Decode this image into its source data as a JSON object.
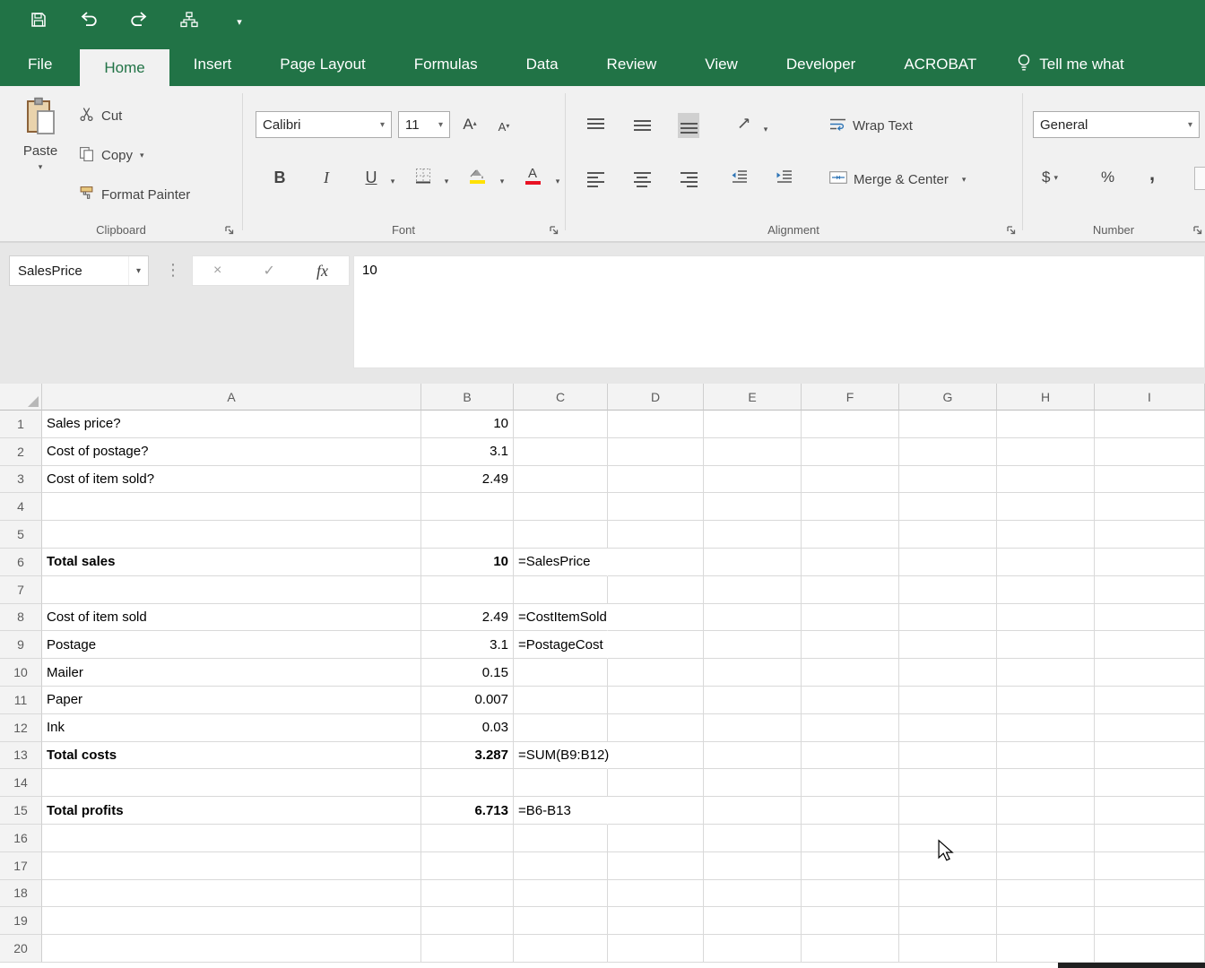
{
  "titlebar": {
    "quick_access_icons": [
      "save-icon",
      "undo-icon",
      "redo-icon",
      "org-chart-icon",
      "customize-quick-access-icon"
    ]
  },
  "ribbon": {
    "tabs": [
      {
        "label": "File",
        "active": false
      },
      {
        "label": "Home",
        "active": true
      },
      {
        "label": "Insert",
        "active": false
      },
      {
        "label": "Page Layout",
        "active": false
      },
      {
        "label": "Formulas",
        "active": false
      },
      {
        "label": "Data",
        "active": false
      },
      {
        "label": "Review",
        "active": false
      },
      {
        "label": "View",
        "active": false
      },
      {
        "label": "Developer",
        "active": false
      },
      {
        "label": "ACROBAT",
        "active": false
      }
    ],
    "tell_me": "Tell me what",
    "groups": {
      "clipboard": {
        "label": "Clipboard",
        "paste": "Paste",
        "cut": "Cut",
        "copy": "Copy",
        "format_painter": "Format Painter"
      },
      "font": {
        "label": "Font",
        "font_name": "Calibri",
        "font_size": "11",
        "bold": "B",
        "italic": "I",
        "underline": "U"
      },
      "alignment": {
        "label": "Alignment",
        "wrap_text": "Wrap Text",
        "merge_center": "Merge & Center"
      },
      "number": {
        "label": "Number",
        "format": "General",
        "currency": "$",
        "percent": "%",
        "comma": ","
      }
    }
  },
  "formula_bar": {
    "name_box": "SalesPrice",
    "cancel": "×",
    "enter": "✓",
    "fx": "fx",
    "content": "10"
  },
  "grid": {
    "columns": [
      "A",
      "B",
      "C",
      "D",
      "E",
      "F",
      "G",
      "H",
      "I"
    ],
    "rows": [
      {
        "n": "1",
        "a": "Sales price?",
        "b": "10",
        "c": ""
      },
      {
        "n": "2",
        "a": "Cost of postage?",
        "b": "3.1",
        "c": ""
      },
      {
        "n": "3",
        "a": "Cost of item sold?",
        "b": "2.49",
        "c": ""
      },
      {
        "n": "4",
        "a": "",
        "b": "",
        "c": ""
      },
      {
        "n": "5",
        "a": "",
        "b": "",
        "c": ""
      },
      {
        "n": "6",
        "a": "Total sales",
        "b": "10",
        "c": "=SalesPrice",
        "bold": true
      },
      {
        "n": "7",
        "a": "",
        "b": "",
        "c": ""
      },
      {
        "n": "8",
        "a": "Cost of item sold",
        "b": "2.49",
        "c": "=CostItemSold"
      },
      {
        "n": "9",
        "a": "Postage",
        "b": "3.1",
        "c": "=PostageCost"
      },
      {
        "n": "10",
        "a": "Mailer",
        "b": "0.15",
        "c": ""
      },
      {
        "n": "11",
        "a": "Paper",
        "b": "0.007",
        "c": ""
      },
      {
        "n": "12",
        "a": "Ink",
        "b": "0.03",
        "c": ""
      },
      {
        "n": "13",
        "a": "Total costs",
        "b": "3.287",
        "c": "=SUM(B9:B12)",
        "bold": true
      },
      {
        "n": "14",
        "a": "",
        "b": "",
        "c": ""
      },
      {
        "n": "15",
        "a": "Total profits",
        "b": "6.713",
        "c": "=B6-B13",
        "bold": true
      },
      {
        "n": "16",
        "a": "",
        "b": "",
        "c": ""
      },
      {
        "n": "17",
        "a": "",
        "b": "",
        "c": ""
      },
      {
        "n": "18",
        "a": "",
        "b": "",
        "c": ""
      },
      {
        "n": "19",
        "a": "",
        "b": "",
        "c": ""
      },
      {
        "n": "20",
        "a": "",
        "b": "",
        "c": ""
      }
    ]
  },
  "colors": {
    "excel_green": "#217346",
    "fill_color_yellow": "#ffe100",
    "font_color_red": "#e81123"
  }
}
